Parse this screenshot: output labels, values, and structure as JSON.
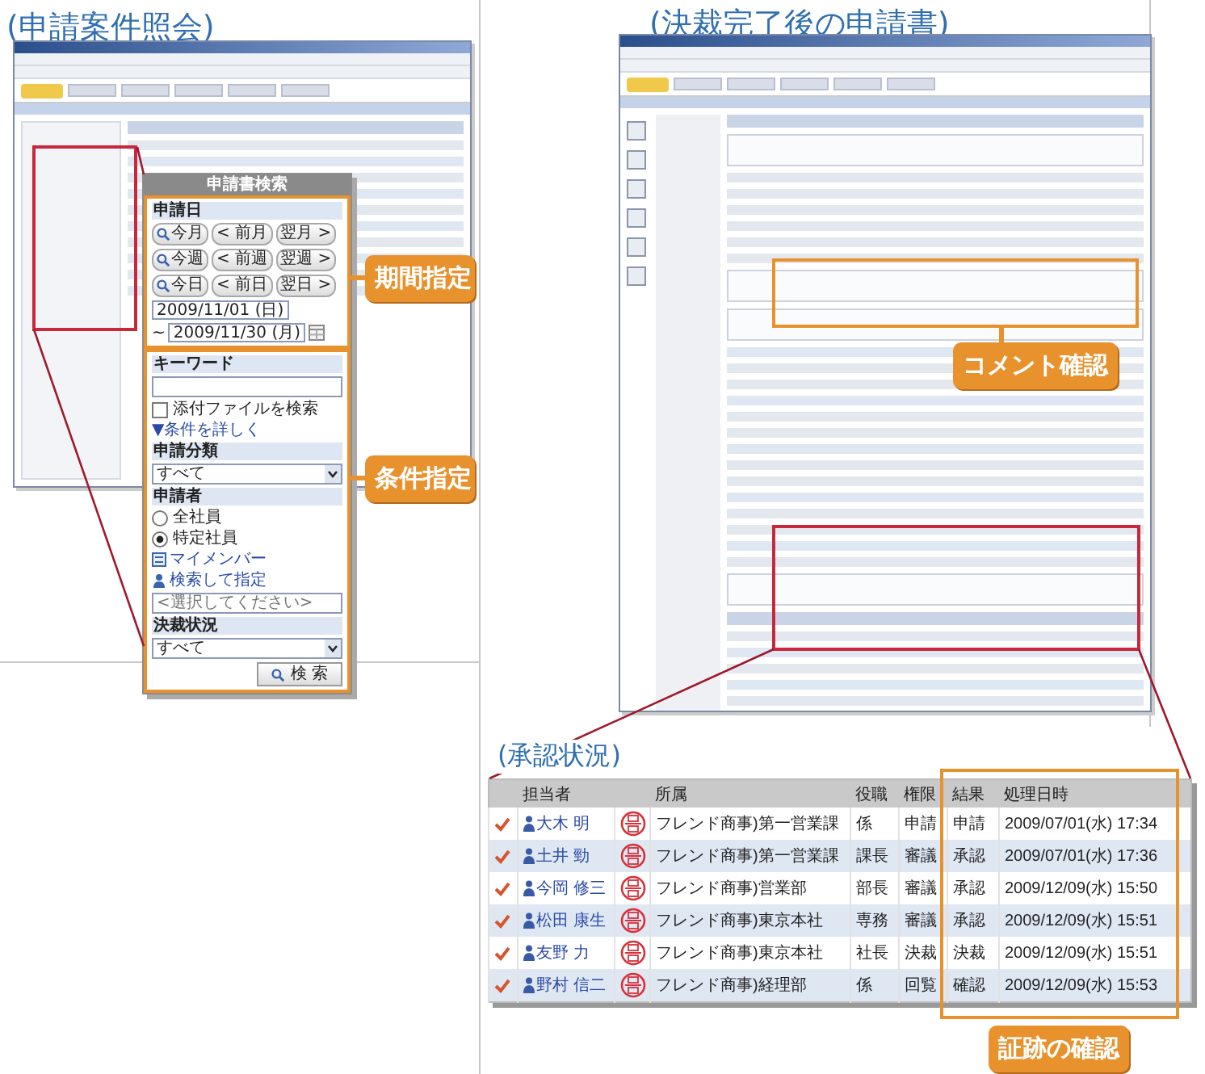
{
  "left_section": {
    "title": "(申請案件照会)"
  },
  "search_panel": {
    "title": "申請書検索",
    "period": {
      "label": "申請日",
      "buttons": [
        {
          "current": "今月",
          "prev": "< 前月",
          "next": "翌月 >"
        },
        {
          "current": "今週",
          "prev": "< 前週",
          "next": "翌週 >"
        },
        {
          "current": "今日",
          "prev": "< 前日",
          "next": "翌日 >"
        }
      ],
      "date_from": "2009/11/01 (日)",
      "separator": "~",
      "date_to": "2009/11/30 (月)"
    },
    "conditions": {
      "keyword_label": "キーワード",
      "attach": {
        "label": "添付ファイルを検索",
        "checked": false
      },
      "more_link": "▼条件を詳しく",
      "category": {
        "label": "申請分類",
        "value": "すべて"
      },
      "applicant": {
        "label": "申請者",
        "options": [
          {
            "label": "全社員",
            "selected": false
          },
          {
            "label": "特定社員",
            "selected": true
          }
        ],
        "links": [
          {
            "kind": "members",
            "label": "マイメンバー"
          },
          {
            "kind": "search",
            "label": "検索して指定"
          }
        ],
        "placeholder": "<選択してください>"
      },
      "status": {
        "label": "決裁状況",
        "value": "すべて"
      },
      "search_button": "検 索"
    }
  },
  "callouts": [
    {
      "text": "期間指定"
    },
    {
      "text": "条件指定"
    },
    {
      "text": "コメント確認"
    },
    {
      "text": "証跡の確認"
    }
  ],
  "right_section": {
    "title": "(決裁完了後の申請書)"
  },
  "approval_section": {
    "title": "(承認状況)",
    "columns": [
      "担当者",
      "所属",
      "役職",
      "権限",
      "結果",
      "処理日時"
    ],
    "rows": [
      {
        "checked": true,
        "name": "大木 明",
        "dept": "フレンド商事)第一営業課",
        "role": "係",
        "authority": "申請",
        "result": "申請",
        "datetime": "2009/07/01(水) 17:34"
      },
      {
        "checked": true,
        "name": "土井 勁",
        "dept": "フレンド商事)第一営業課",
        "role": "課長",
        "authority": "審議",
        "result": "承認",
        "datetime": "2009/07/01(水) 17:36"
      },
      {
        "checked": true,
        "name": "今岡 修三",
        "dept": "フレンド商事)営業部",
        "role": "部長",
        "authority": "審議",
        "result": "承認",
        "datetime": "2009/12/09(水) 15:50"
      },
      {
        "checked": true,
        "name": "松田 康生",
        "dept": "フレンド商事)東京本社",
        "role": "専務",
        "authority": "審議",
        "result": "承認",
        "datetime": "2009/12/09(水) 15:51"
      },
      {
        "checked": true,
        "name": "友野 力",
        "dept": "フレンド商事)東京本社",
        "role": "社長",
        "authority": "決裁",
        "result": "決裁",
        "datetime": "2009/12/09(水) 15:51"
      },
      {
        "checked": true,
        "name": "野村 信二",
        "dept": "フレンド商事)経理部",
        "role": "係",
        "authority": "回覧",
        "result": "確認",
        "datetime": "2009/12/09(水) 15:53"
      }
    ]
  }
}
